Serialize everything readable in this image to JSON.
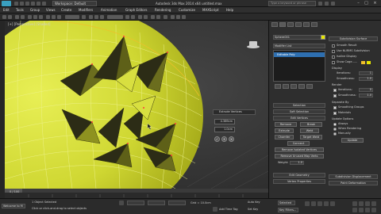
{
  "title_bar": {
    "workspace": "Workspace: Default",
    "app_title": "Autodesk 3ds Max 2014 x64     untitled.max",
    "search_placeholder": "Type a keyword or phrase"
  },
  "menu": [
    "Edit",
    "Tools",
    "Group",
    "Views",
    "Create",
    "Modifiers",
    "Animation",
    "Graph Editors",
    "Rendering",
    "Customize",
    "MAXScript",
    "Help"
  ],
  "viewport": {
    "label": "[+] [Perspective] [Shaded]",
    "caddy": {
      "title": "Extrude Vertices",
      "height": "4.389cm",
      "width": "1.0cm"
    }
  },
  "timeline": {
    "frame": "0 / 100"
  },
  "status": {
    "selected": "1 Object Selected",
    "hint": "Click or click-and-drag to select objects",
    "welcome": "Welcome to M",
    "grid": "Grid = 10.0cm",
    "add_time_tag": "Add Time Tag",
    "auto_key": "Auto Key",
    "set_key": "Set Key",
    "selected_dd": "Selected",
    "key_filters": "Key Filters..."
  },
  "command_panel": {
    "object_name": "Sphere001",
    "modifier_list": "Modifier List",
    "stack_item": "Editable Poly",
    "selection": {
      "header": "Selection",
      "soft": "Soft Selection",
      "edit_vertices": "Edit Vertices",
      "remove": "Remove",
      "break": "Break",
      "extrude": "Extrude",
      "weld": "Weld",
      "chamfer": "Chamfer",
      "target_weld": "Target Weld",
      "connect": "Connect",
      "remove_isolated": "Remove Isolated Vertices",
      "remove_unused": "Remove Unused Map Verts",
      "weight_label": "Weight:",
      "weight_value": "1.0",
      "edit_geometry": "Edit Geometry",
      "vertex_properties": "Vertex Properties"
    },
    "subdivision": {
      "header": "Subdivision Surface",
      "smooth_result": "Smooth Result",
      "use_nurms": "Use NURMS Subdivision",
      "isoline": "Isoline Display",
      "show_cage": "Show Cage......",
      "display": "Display",
      "iterations_label": "Iterations:",
      "iterations": "1",
      "smoothness_label": "Smoothness:",
      "smoothness": "1.0",
      "render": "Render",
      "r_iterations": "0",
      "r_smoothness": "1.0",
      "separate_by": "Separate By",
      "smoothing_groups": "Smoothing Groups",
      "materials": "Materials",
      "update_options": "Update Options",
      "always": "Always",
      "when_rendering": "When Rendering",
      "manually": "Manually",
      "update": "Update",
      "subdivision_displacement": "Subdivision Displacement",
      "paint_deformation": "Paint Deformation"
    }
  },
  "colors": {
    "sphere": "#d9e23a",
    "cage": "#f0c02a",
    "selection_blue": "#2e6fb0"
  }
}
